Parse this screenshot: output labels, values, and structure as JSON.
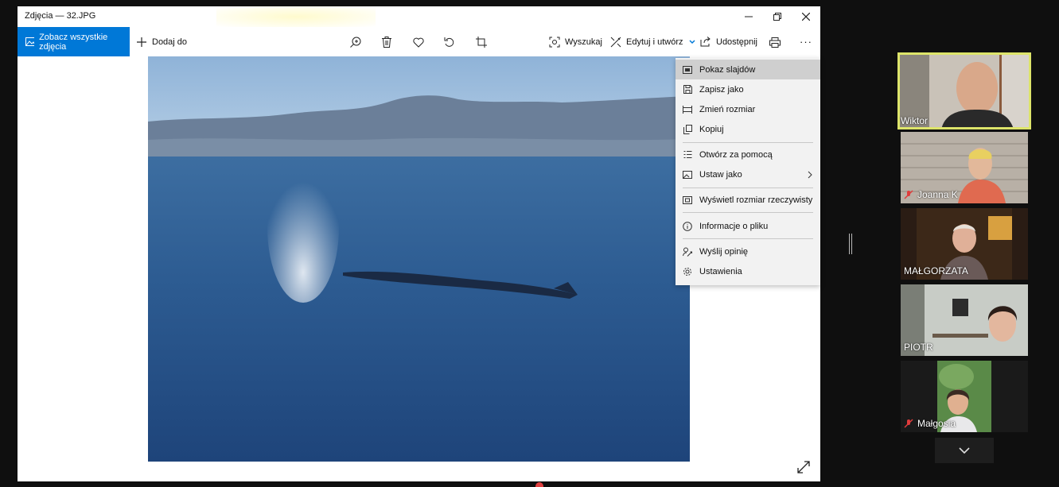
{
  "window": {
    "title": "Zdjęcia — 32.JPG",
    "controls": [
      "minimize",
      "restore",
      "close"
    ]
  },
  "toolbar": {
    "view_all_label": "Zobacz wszystkie zdjęcia",
    "add_to_label": "Dodaj do",
    "search_label": "Wyszukaj",
    "edit_create_label": "Edytuj i utwórz",
    "share_label": "Udostępnij",
    "more_label": "···"
  },
  "context_menu": {
    "items": [
      {
        "label": "Pokaz slajdów",
        "icon": "slideshow-icon"
      },
      {
        "label": "Zapisz jako",
        "icon": "save-icon"
      },
      {
        "label": "Zmień rozmiar",
        "icon": "resize-icon"
      },
      {
        "label": "Kopiuj",
        "icon": "copy-icon"
      },
      {
        "label": "Otwórz za pomocą",
        "icon": "open-with-icon"
      },
      {
        "label": "Ustaw jako",
        "icon": "set-as-icon"
      },
      {
        "label": "Wyświetl rozmiar rzeczywisty",
        "icon": "actual-size-icon"
      },
      {
        "label": "Informacje o pliku",
        "icon": "info-icon"
      },
      {
        "label": "Wyślij opinię",
        "icon": "feedback-icon"
      },
      {
        "label": "Ustawienia",
        "icon": "settings-icon"
      }
    ]
  },
  "participants": [
    {
      "name": "Wiktor",
      "active": true,
      "muted": false
    },
    {
      "name": "Joanna K",
      "active": false,
      "muted": true
    },
    {
      "name": "MAŁGORZATA",
      "active": false,
      "muted": false
    },
    {
      "name": "PIOTR",
      "active": false,
      "muted": false
    },
    {
      "name": "Małgosia",
      "active": false,
      "muted": true
    }
  ],
  "colors": {
    "accent": "#0078d7",
    "active_speaker": "#dde46a",
    "mute": "#e03c3c"
  }
}
